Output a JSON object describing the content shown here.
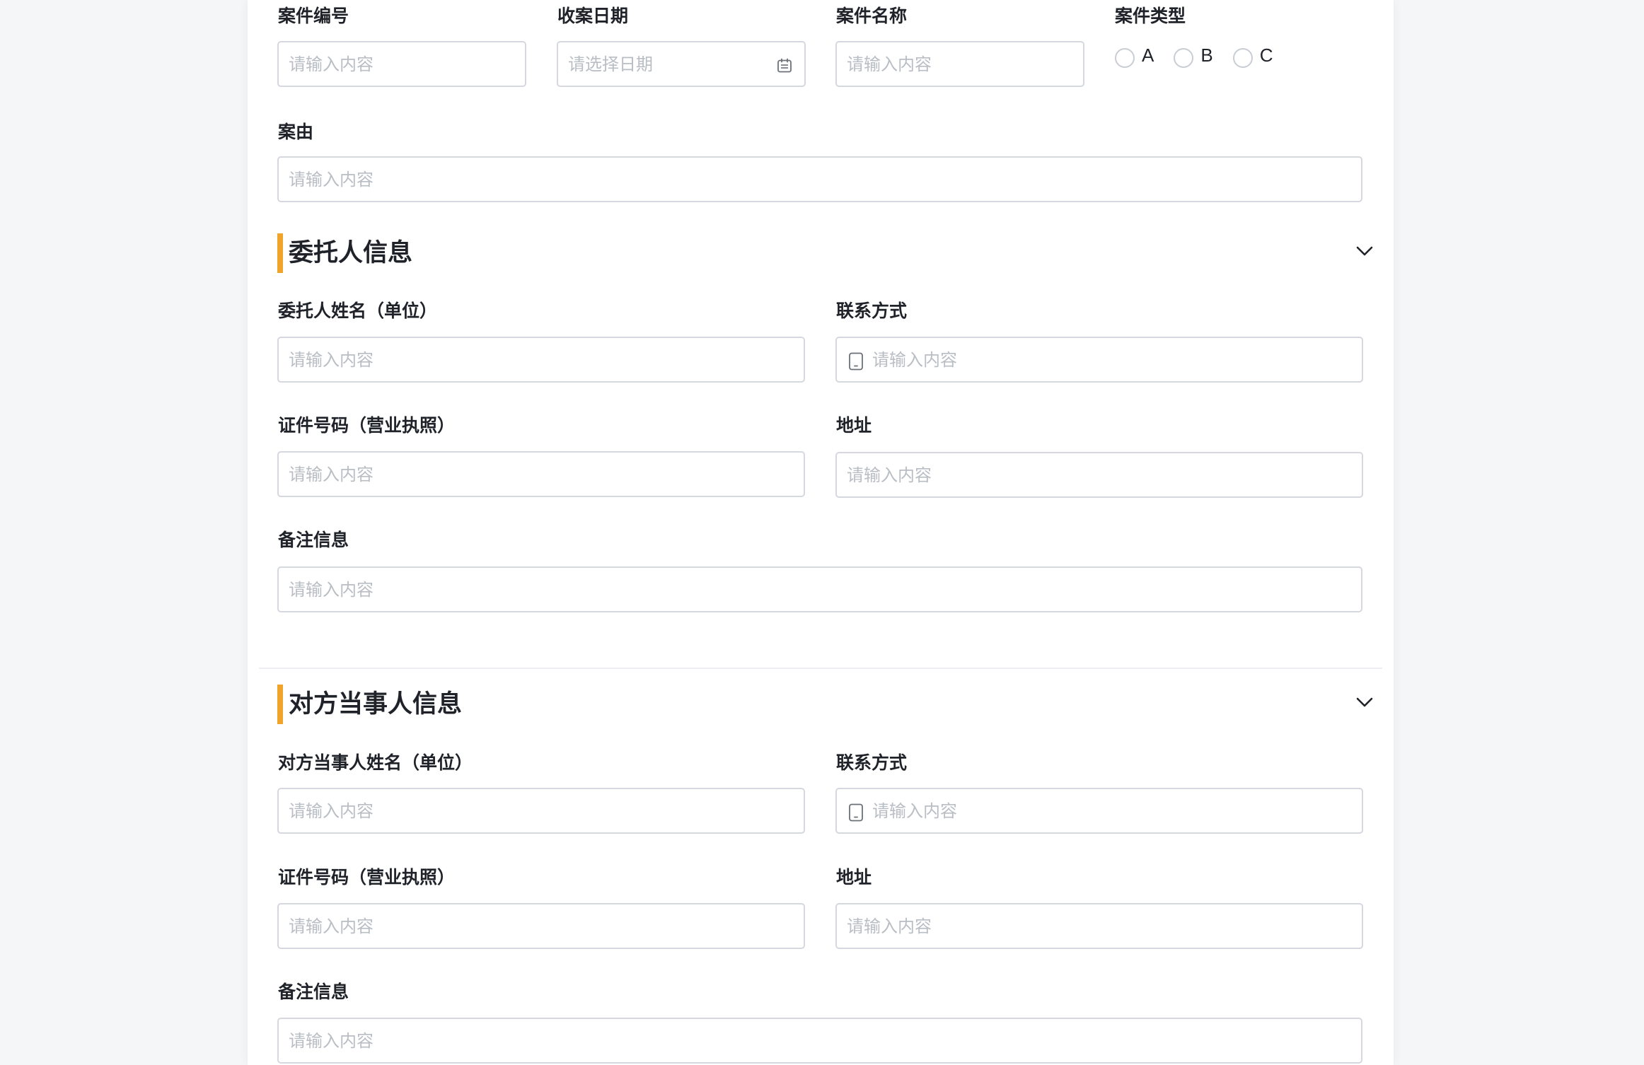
{
  "case": {
    "number_label": "案件编号",
    "number_placeholder": "请输入内容",
    "date_label": "收案日期",
    "date_placeholder": "请选择日期",
    "name_label": "案件名称",
    "name_placeholder": "请输入内容",
    "type_label": "案件类型",
    "type_options": [
      "A",
      "B",
      "C"
    ],
    "cause_label": "案由",
    "cause_placeholder": "请输入内容"
  },
  "client": {
    "title": "委托人信息",
    "name_label": "委托人姓名（单位）",
    "name_placeholder": "请输入内容",
    "contact_label": "联系方式",
    "contact_placeholder": "请输入内容",
    "id_label": "证件号码（营业执照）",
    "id_placeholder": "请输入内容",
    "address_label": "地址",
    "address_placeholder": "请输入内容",
    "remark_label": "备注信息",
    "remark_placeholder": "请输入内容"
  },
  "opponent": {
    "title": "对方当事人信息",
    "name_label": "对方当事人姓名（单位）",
    "name_placeholder": "请输入内容",
    "contact_label": "联系方式",
    "contact_placeholder": "请输入内容",
    "id_label": "证件号码（营业执照）",
    "id_placeholder": "请输入内容",
    "address_label": "地址",
    "address_placeholder": "请输入内容",
    "remark_label": "备注信息",
    "remark_placeholder": "请输入内容"
  },
  "colors": {
    "section_accent": "#f0a42b",
    "input_border": "#d5d8de",
    "placeholder": "#b9bdc4"
  }
}
